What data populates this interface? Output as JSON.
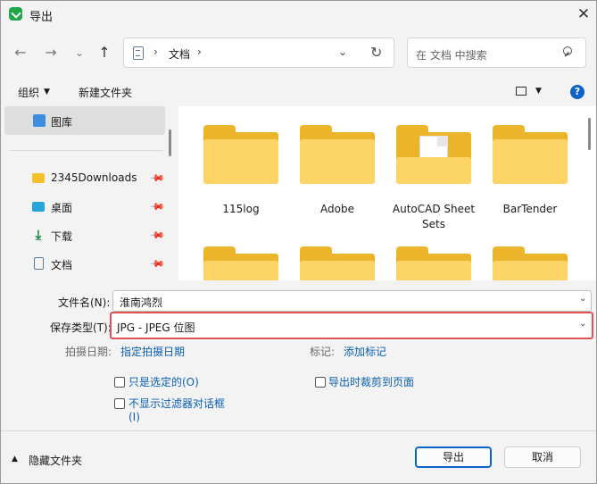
{
  "window": {
    "title": "导出",
    "close_glyph": "✕"
  },
  "nav": {
    "back": "←",
    "forward": "→",
    "recent": "⌄",
    "up": "↑"
  },
  "address": {
    "separator": "›",
    "crumb": "文档",
    "dropdown": "⌄",
    "refresh": "↻"
  },
  "search": {
    "placeholder": "在 文档 中搜索"
  },
  "toolbar": {
    "organize": "组织",
    "organize_caret": "▼",
    "new_folder": "新建文件夹",
    "view_caret": "▼",
    "help": "?"
  },
  "sidebar": {
    "selected": "图库",
    "items": [
      {
        "label": "2345Downloads",
        "icon": "folder-icon",
        "pinned": true
      },
      {
        "label": "桌面",
        "icon": "desktop-icon",
        "pinned": true
      },
      {
        "label": "下载",
        "icon": "download-icon",
        "pinned": true
      },
      {
        "label": "文档",
        "icon": "document-icon",
        "pinned": true
      }
    ],
    "pin_glyph": "📌",
    "download_glyph": "⤓"
  },
  "folders": [
    {
      "name": "115log"
    },
    {
      "name": "Adobe"
    },
    {
      "name": "AutoCAD Sheet Sets",
      "line1": "AutoCAD Sheet",
      "line2": "Sets"
    },
    {
      "name": "BarTender"
    }
  ],
  "form": {
    "filename_label": "文件名(N):",
    "filename_value": "淮南鸿烈",
    "type_label": "保存类型(T):",
    "type_value": "JPG - JPEG 位图",
    "caret": "⌄",
    "date_label": "拍摄日期:",
    "date_link": "指定拍摄日期",
    "tag_label": "标记:",
    "tag_link": "添加标记",
    "opt_selected_only": "只是选定的(O)",
    "opt_crop": "导出时裁剪到页面",
    "opt_no_filter_line1": "不显示过滤器对话框",
    "opt_no_filter_line2": "(I)"
  },
  "footer": {
    "hide_folders_caret": "▲",
    "hide_folders": "隐藏文件夹",
    "export": "导出",
    "cancel": "取消"
  }
}
